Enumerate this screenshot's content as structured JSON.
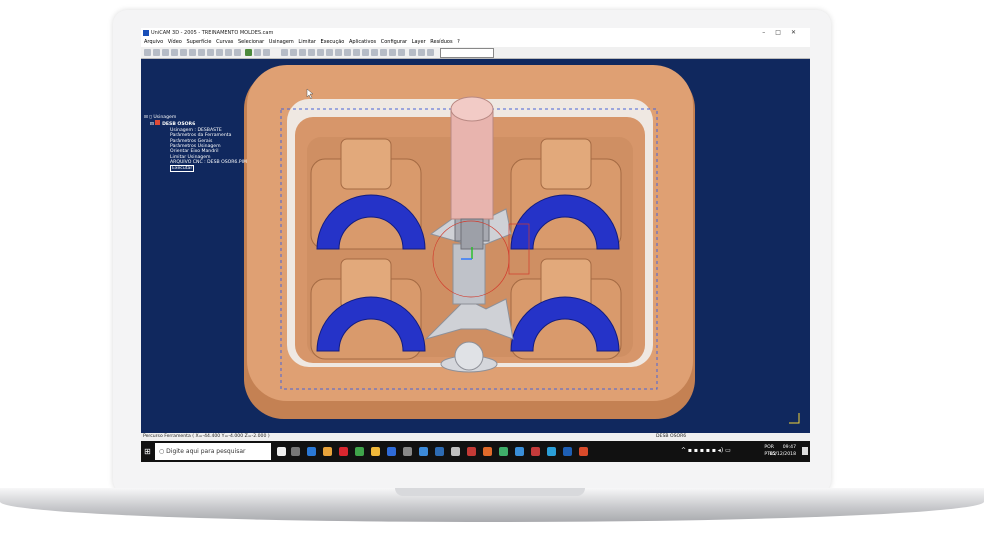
{
  "window": {
    "title": "UniCAM 3D - 2005 - TREINAMENTO MOLDES.cam",
    "controls": [
      "–",
      "□",
      "✕"
    ]
  },
  "menu": [
    "Arquivo",
    "Vídeo",
    "Superfície",
    "Curvas",
    "Selecionar",
    "Usinagem",
    "Limitar",
    "Execução",
    "Aplicativos",
    "Configurar",
    "Layer",
    "Resíduos",
    "?"
  ],
  "tree": {
    "root": "Usinagem",
    "item": "DESB OSOR6",
    "children": [
      "Usinagem : DESBASTE",
      "Parâmetros da Ferramenta",
      "Parâmetros Gerais",
      "Parâmetros Usinagem",
      "Orientar Eixo Mandril",
      "Limitar Usinagem",
      "ARQUIVO CNC : DESB OSOR6.PIM",
      "Executar"
    ]
  },
  "status": {
    "left": "Percurso Ferramenta ( X=-44.400 Y=-4.000 Z=-2.000 )",
    "right": "DESB OSOR6"
  },
  "taskbar": {
    "search_placeholder": "Digite aqui para pesquisar",
    "lang1": "POR",
    "lang2": "PTB2",
    "time": "09:47",
    "date": "05/12/2018"
  },
  "colors": {
    "viewport": "#10285e",
    "mold": "#d99a6c",
    "blue_insert": "#2533c8",
    "core": "#cfd1d6",
    "tool": "#e8b4ae"
  }
}
